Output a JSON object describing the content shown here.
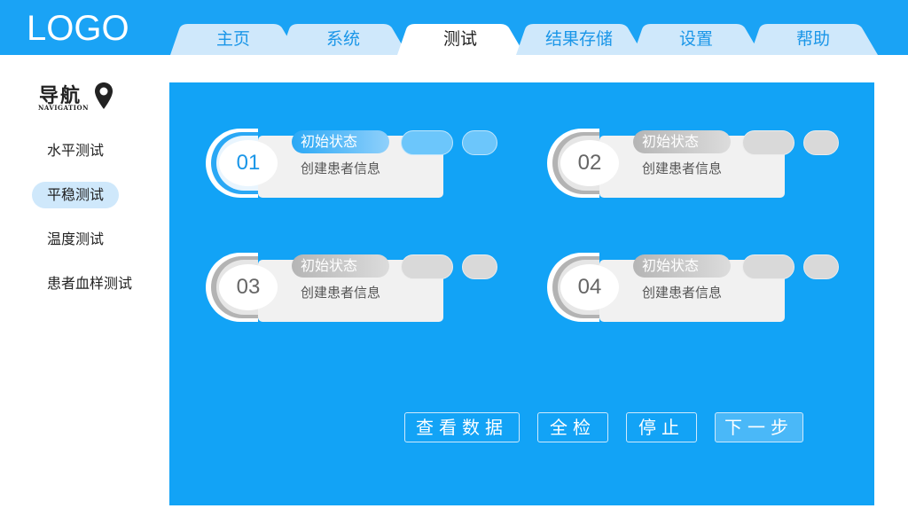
{
  "header": {
    "logo": "LOGO",
    "tabs": [
      {
        "label": "主页",
        "active": false
      },
      {
        "label": "系统",
        "active": false
      },
      {
        "label": "测试",
        "active": true
      },
      {
        "label": "结果存储",
        "active": false
      },
      {
        "label": "设置",
        "active": false
      },
      {
        "label": "帮助",
        "active": false
      }
    ]
  },
  "sidebar": {
    "title": "导航",
    "subtitle": "NAVIGATION",
    "items": [
      {
        "label": "水平测试",
        "active": false
      },
      {
        "label": "平稳测试",
        "active": true
      },
      {
        "label": "温度测试",
        "active": false
      },
      {
        "label": "患者血样测试",
        "active": false
      }
    ]
  },
  "cards": [
    {
      "number": "01",
      "status": "初始状态",
      "info": "创建患者信息",
      "style": "blue"
    },
    {
      "number": "02",
      "status": "初始状态",
      "info": "创建患者信息",
      "style": "grey"
    },
    {
      "number": "03",
      "status": "初始状态",
      "info": "创建患者信息",
      "style": "grey"
    },
    {
      "number": "04",
      "status": "初始状态",
      "info": "创建患者信息",
      "style": "grey"
    }
  ],
  "actions": {
    "view_data": "查看数据",
    "full_check": "全检",
    "stop": "停止",
    "next_step": "下一步"
  },
  "colors": {
    "header": "#1aa3f5",
    "panel": "#12a3f6",
    "tab_bg": "#cfe8fb",
    "active_side": "#cfe8fb"
  }
}
